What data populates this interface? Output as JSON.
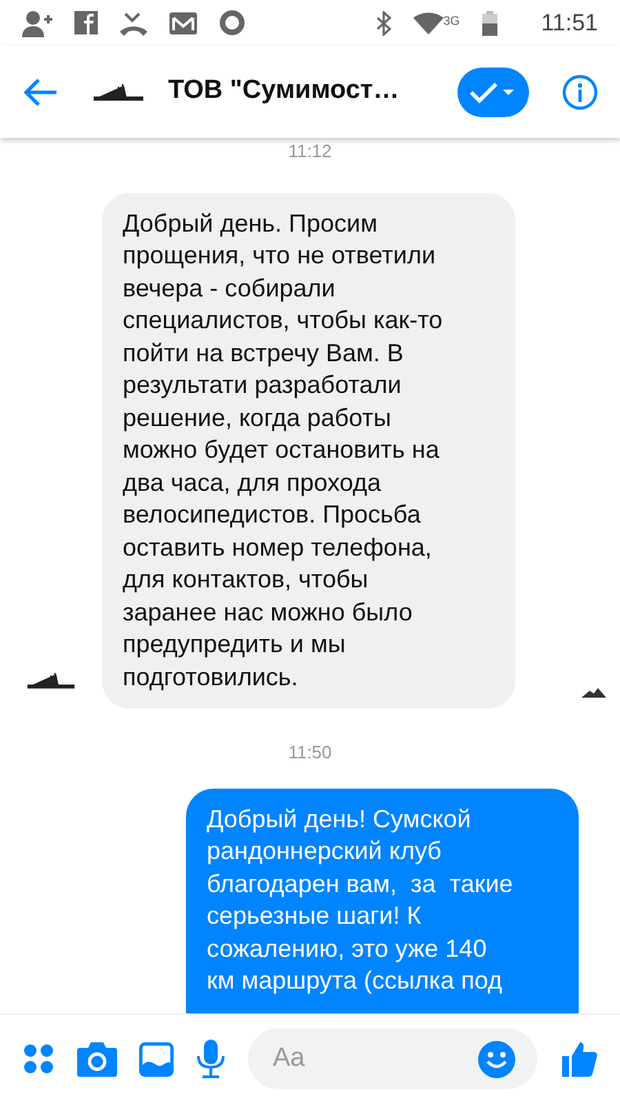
{
  "status_bar": {
    "network": "3G",
    "time": "11:51"
  },
  "header": {
    "title": "ТОВ \"Сумимост…"
  },
  "messages": [
    {
      "kind": "time",
      "text": "11:12"
    },
    {
      "kind": "incoming",
      "text": "Добрый день. Просим\nпрощения, что не ответили\nвечера - собирали\nспециалистов, чтобы как-то\nпойти на встречу Вам. В\nрезультати разработали\nрешение, когда работы\nможно будет остановить на\nдва часа, для прохода\nвелосипедистов. Просьба\nоставить номер телефона,\nдля контактов, чтобы\nзаранее нас можно было\nпредупредить и мы\nподготовились."
    },
    {
      "kind": "time",
      "text": "11:50"
    },
    {
      "kind": "outgoing",
      "text": "Добрый день! Сумской\nрандоннерский клуб\nблагодарен вам,  за  такие\nсерьезные шаги! К\nсожалению, это уже 140\nкм маршрута (ссылка под"
    }
  ],
  "composer": {
    "placeholder": "Aa"
  }
}
